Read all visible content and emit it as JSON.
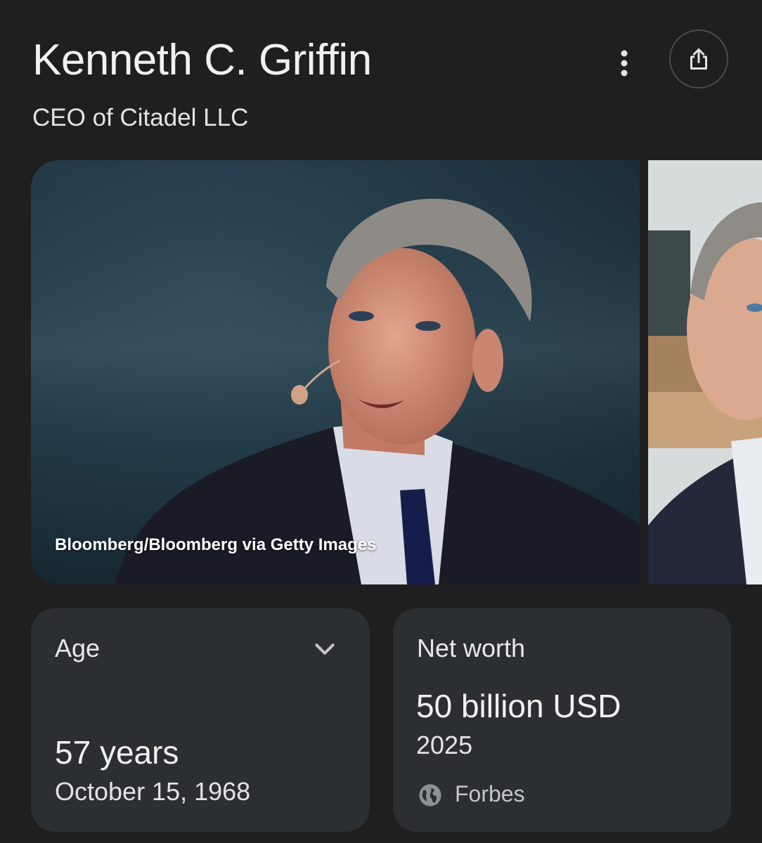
{
  "header": {
    "title": "Kenneth C. Griffin",
    "subtitle": "CEO of Citadel LLC",
    "more_icon": "more-vert-icon",
    "share_icon": "share-icon"
  },
  "images": {
    "main_caption": "Bloomberg/Bloomberg via Getty Images"
  },
  "age_card": {
    "label": "Age",
    "value": "57 years",
    "date": "October 15, 1968",
    "expand_icon": "chevron-down-icon"
  },
  "net_worth_card": {
    "label": "Net worth",
    "value": "50 billion USD",
    "year": "2025",
    "source": "Forbes",
    "source_icon": "globe-icon"
  },
  "colors": {
    "background": "#1f1f1f",
    "card": "#2c2f32",
    "text": "#e3e3e3"
  }
}
